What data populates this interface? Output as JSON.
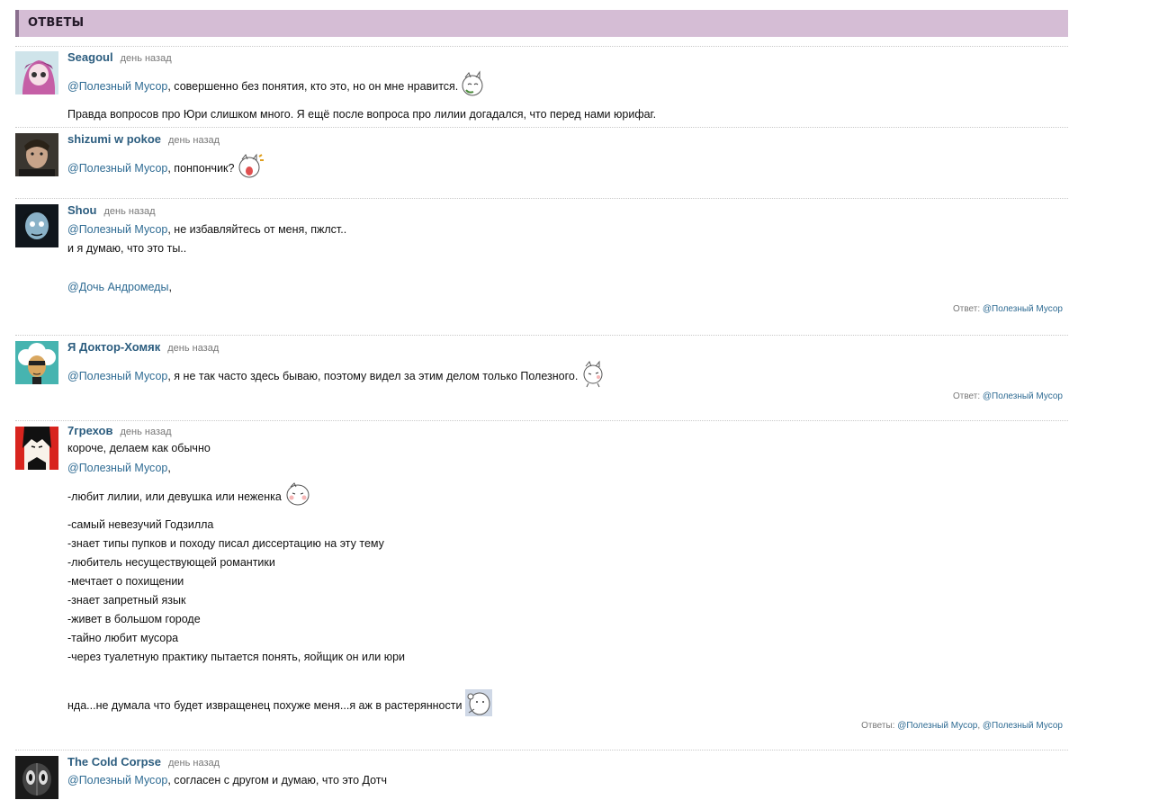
{
  "section": {
    "title": "ОТВЕТЫ"
  },
  "colors": {
    "header_bg": "#d5bdd5",
    "header_accent": "#8a6f8e",
    "link": "#2e6b93",
    "author": "#2c5d7f"
  },
  "comments": [
    {
      "author": "Seagoul",
      "time": "день назад",
      "mention": "@Полезный Мусор",
      "text1": ", совершенно без понятия, кто это, но он мне нравится.",
      "text2": "Правда вопросов про Юри слишком много. Я ещё после вопроса про лилии догадался, что перед нами юрифаг."
    },
    {
      "author": "shizumi w pokoe",
      "time": "день назад",
      "mention": "@Полезный Мусор",
      "text1": ", понпончик?"
    },
    {
      "author": "Shou",
      "time": "день назад",
      "mention": "@Полезный Мусор",
      "text1": ", не избавляйтесь от меня, пжлст..",
      "text2": "и я думаю, что это ты..",
      "mention2": "@Дочь Андромеды",
      "text3": ",",
      "reply_label": "Ответ:",
      "reply_to": "@Полезный Мусор"
    },
    {
      "author": "Я Доктор-Хомяк",
      "time": "день назад",
      "mention": "@Полезный Мусор",
      "text1": ", я не так часто здесь бываю, поэтому видел за этим делом только Полезного.",
      "reply_label": "Ответ:",
      "reply_to": "@Полезный Мусор"
    },
    {
      "author": "7грехов",
      "time": "день назад",
      "intro": "короче, делаем как обычно",
      "mention": "@Полезный Мусор",
      "text1": ",",
      "lines": [
        "-любит лилии, или девушка или неженка",
        "-самый невезучий Годзилла",
        "-знает типы пупков и походу писал диссертацию на эту тему",
        "-любитель несуществующей романтики",
        "-мечтает о похищении",
        "-знает запретный язык",
        "-живет в большом городе",
        "-тайно любит мусора",
        "-через туалетную практику пытается понять, яойщик он или юри"
      ],
      "outro": "нда...не думала что будет извращенец похуже меня...я аж в растерянности",
      "reply_label": "Ответы:",
      "reply_to": "@Полезный Мусор",
      "reply_sep": ", ",
      "reply_to2": "@Полезный Мусор"
    },
    {
      "author": "The  Cold  Corpse",
      "time": "день назад",
      "mention": "@Полезный Мусор",
      "text1": ", согласен с другом и думаю, что это Дотч"
    }
  ]
}
